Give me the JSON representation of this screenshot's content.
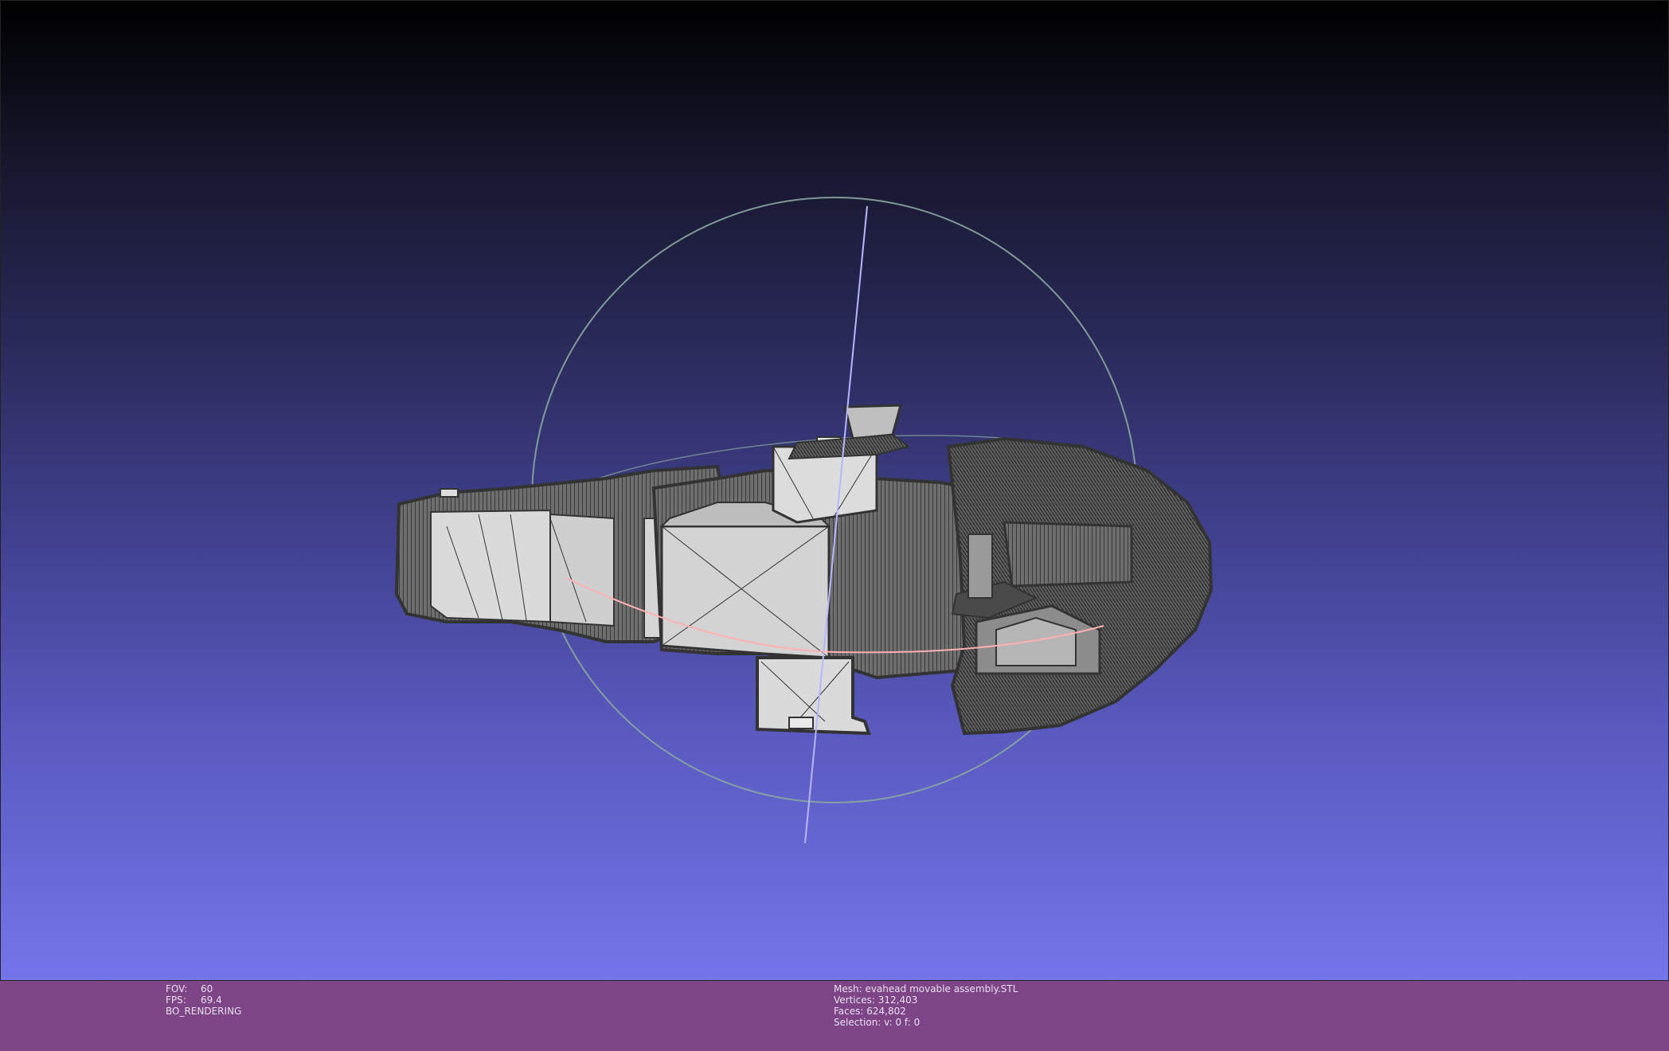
{
  "viewport": {
    "background_top": "#000000",
    "background_bottom": "#7575ea",
    "mesh_fill": "#d8d8d8",
    "mesh_edge": "#3a3a3a",
    "trackball_color": "#8aa7a0",
    "trackball_vertical_color": "#b7b7ff",
    "trackball_horizontal_color": "#ffb0b0"
  },
  "status": {
    "background": "#7e4586",
    "fov_label": "FOV:",
    "fov_value": "60",
    "fps_label": "FPS:",
    "fps_value": "69.4",
    "render_mode": "BO_RENDERING",
    "mesh_line": "Mesh: evahead movable assembly.STL",
    "vertices_line": "Vertices: 312,403",
    "faces_line": "Faces: 624,802",
    "selection_line": "Selection: v: 0 f: 0"
  }
}
